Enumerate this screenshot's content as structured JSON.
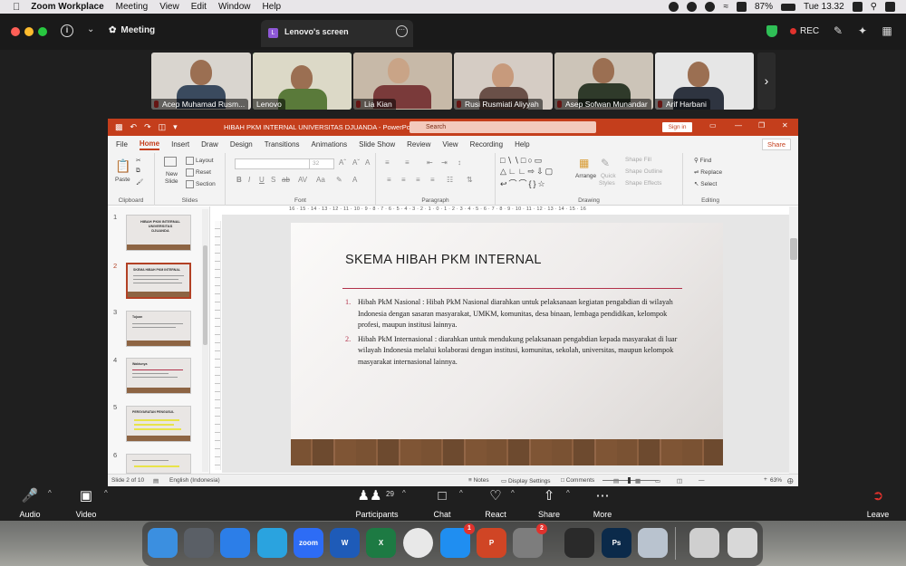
{
  "mac_menubar": {
    "app": "Zoom Workplace",
    "items": [
      "Meeting",
      "View",
      "Edit",
      "Window",
      "Help"
    ],
    "battery": "87%",
    "clock": "Tue 13.32"
  },
  "zoom_top": {
    "meeting_label": "Meeting",
    "share_tab_badge": "L",
    "share_tab_label": "Lenovo's screen",
    "rec_label": "REC"
  },
  "participants_strip": [
    {
      "name": "Acep Muhamad Rusm...",
      "bg": "#d9d5cf",
      "shirt": "#3a4a5e"
    },
    {
      "name": "Lenovo",
      "bg": "#dcd9c7",
      "shirt": "#5a7a3a"
    },
    {
      "name": "Lia Kian",
      "bg": "#c7b9a8",
      "shirt": "#7a3a3a"
    },
    {
      "name": "Rusi Rusmiati Aliyyah",
      "bg": "#d5ccc4",
      "shirt": "#6a5048"
    },
    {
      "name": "Asep Sofwan Munandar",
      "bg": "#ccc4b8",
      "shirt": "#2f3a2a"
    },
    {
      "name": "Arif Harbani",
      "bg": "#e6e6e6",
      "shirt": "#2e3440"
    }
  ],
  "ppt": {
    "doc_title": "HIBAH PKM INTERNAL UNIVERSITAS DJUANDA  -  PowerPoint",
    "search_placeholder": "Search",
    "sign_in": "Sign in",
    "tabs": [
      "File",
      "Home",
      "Insert",
      "Draw",
      "Design",
      "Transitions",
      "Animations",
      "Slide Show",
      "Review",
      "View",
      "Recording",
      "Help"
    ],
    "share_btn": "Share",
    "ribbon": {
      "paste": "Paste",
      "new_slide_1": "New",
      "new_slide_2": "Slide",
      "layout": "Layout",
      "reset": "Reset",
      "section": "Section",
      "font_size": "32",
      "arrange": "Arrange",
      "quick_styles_1": "Quick",
      "quick_styles_2": "Styles",
      "shape_fill": "Shape Fill",
      "shape_outline": "Shape Outline",
      "shape_effects": "Shape Effects",
      "find": "Find",
      "replace": "Replace",
      "select": "Select",
      "groups": [
        "Clipboard",
        "Slides",
        "Font",
        "Paragraph",
        "Drawing",
        "Editing"
      ]
    },
    "thumbnails": [
      {
        "num": "1",
        "title": "HIBAH PKM INTERNAL UNIVERSITAS DJUANDA"
      },
      {
        "num": "2",
        "title": "SKEMA HIBAH PKM INTERNAL"
      },
      {
        "num": "3",
        "title": "Tujuan"
      },
      {
        "num": "4",
        "title": "Waktunya"
      },
      {
        "num": "5",
        "title": "PERSYARATAN PENGUSUL"
      },
      {
        "num": "6",
        "title": ""
      }
    ],
    "ruler": "16 · 15 · 14 · 13 · 12 · 11 · 10 · 9 · 8 · 7 · 6 · 5 · 4 · 3 · 2 · 1 · 0 · 1 · 2 · 3 · 4 · 5 · 6 · 7 · 8 · 9 · 10 · 11 · 12 · 13 · 14 · 15 · 16",
    "slide": {
      "title": "SKEMA HIBAH PKM INTERNAL",
      "items": [
        {
          "num": "1.",
          "text": "Hibah PkM Nasional : Hibah PkM Nasional diarahkan untuk pelaksanaan kegiatan pengabdian di wilayah Indonesia dengan sasaran masyarakat, UMKM, komunitas, desa binaan, lembaga pendidikan, kelompok profesi, maupun institusi lainnya."
        },
        {
          "num": "2.",
          "text": "Hibah PkM Internasional : diarahkan untuk mendukung pelaksanaan pengabdian kepada masyarakat di luar wilayah Indonesia melalui kolaborasi dengan institusi, komunitas, sekolah, universitas, maupun kelompok masyarakat internasional lainnya."
        }
      ]
    },
    "status": {
      "slide_of": "Slide 2 of 10",
      "language": "English (Indonesia)",
      "notes": "Notes",
      "display_settings": "Display Settings",
      "comments": "Comments",
      "zoom": "63%"
    }
  },
  "zoom_controls": {
    "audio": "Audio",
    "video": "Video",
    "participants": "Participants",
    "participants_count": "29",
    "chat": "Chat",
    "react": "React",
    "share": "Share",
    "more": "More",
    "leave": "Leave"
  },
  "dock": [
    {
      "name": "finder",
      "label": "",
      "color": "#3b8fe0",
      "badge": ""
    },
    {
      "name": "launchpad",
      "label": "",
      "color": "#5a5f66",
      "badge": ""
    },
    {
      "name": "safari",
      "label": "",
      "color": "#2c7ee8",
      "badge": ""
    },
    {
      "name": "telegram",
      "label": "",
      "color": "#2aa3df",
      "badge": ""
    },
    {
      "name": "zoom",
      "label": "zoom",
      "color": "#2d6cf5",
      "badge": ""
    },
    {
      "name": "word",
      "label": "W",
      "color": "#1e5bb8",
      "badge": ""
    },
    {
      "name": "excel",
      "label": "X",
      "color": "#1d7a43",
      "badge": ""
    },
    {
      "name": "chrome",
      "label": "",
      "color": "#e8e8e8",
      "badge": ""
    },
    {
      "name": "app-store",
      "label": "",
      "color": "#1f8ef1",
      "badge": "1"
    },
    {
      "name": "powerpoint",
      "label": "P",
      "color": "#d04525",
      "badge": ""
    },
    {
      "name": "system-settings",
      "label": "",
      "color": "#7d7d7d",
      "badge": "2"
    },
    {
      "name": "quicktime",
      "label": "",
      "color": "#2a2a2a",
      "badge": ""
    },
    {
      "name": "photoshop",
      "label": "Ps",
      "color": "#0b2a4a",
      "badge": ""
    },
    {
      "name": "preview",
      "label": "",
      "color": "#b9c3cf",
      "badge": ""
    },
    {
      "name": "downloads",
      "label": "",
      "color": "#cfcfcf",
      "badge": ""
    },
    {
      "name": "trash",
      "label": "",
      "color": "#d8d8d8",
      "badge": ""
    }
  ]
}
